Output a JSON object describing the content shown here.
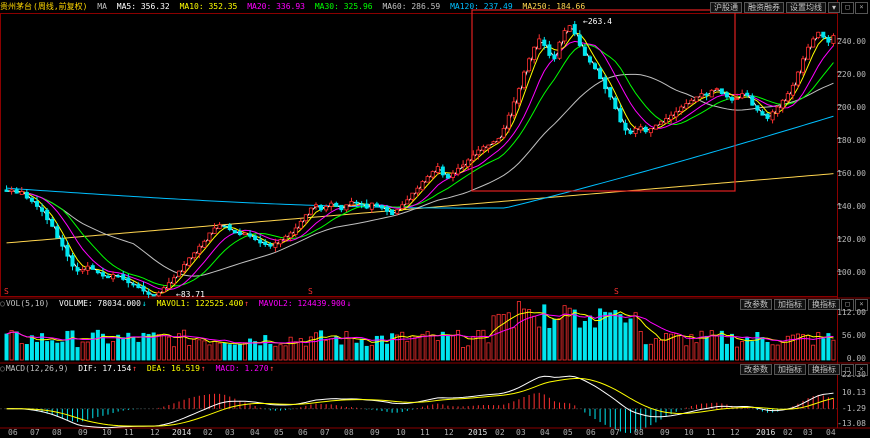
{
  "stock_name": "贵州茅台",
  "adjust_mode": "(周线,前复权)",
  "price_header": {
    "prefix": "MA",
    "items": [
      {
        "label": "MA5: 356.32",
        "color": "#ffffff"
      },
      {
        "label": "MA10: 352.35",
        "color": "#ffff00"
      },
      {
        "label": "MA20: 336.93",
        "color": "#ff00ff"
      },
      {
        "label": "MA30: 325.96",
        "color": "#00ff00"
      },
      {
        "label": "MA60: 286.59",
        "color": "#c0c0c0"
      },
      {
        "label": "MA120: 237.49",
        "color": "#00bfff"
      },
      {
        "label": "MA250: 184.66",
        "color": "#ffd54f"
      }
    ]
  },
  "top_buttons": [
    "沪股通",
    "融资融券",
    "设置均线"
  ],
  "vol_header": {
    "name": "VOL(5,10)",
    "volume": "VOLUME: 78034.000",
    "mavol1": "MAVOL1: 122525.400",
    "mavol2": "MAVOL2: 124439.900"
  },
  "macd_header": {
    "name": "MACD(12,26,9)",
    "dif": "DIF: 17.154",
    "dea": "DEA: 16.519",
    "macd": "MACD: 1.270"
  },
  "panel_buttons": [
    "改参数",
    "加指标",
    "换指标"
  ],
  "annotations": {
    "high": "263.4",
    "low": "83.71"
  },
  "colors": {
    "up": "#ff3030",
    "down": "#00e5ee",
    "selection": "#e02020",
    "grid": "#8b0000"
  },
  "price_axis": [
    "240.00",
    "220.00",
    "200.00",
    "180.00",
    "160.00",
    "140.00",
    "120.00",
    "100.00"
  ],
  "vol_axis": [
    "112.00",
    "56.00",
    "0.00"
  ],
  "macd_axis": [
    "22.30",
    "10.13",
    "-1.29",
    "-13.08"
  ],
  "time_axis": [
    {
      "t": "06",
      "x": 8
    },
    {
      "t": "07",
      "x": 30
    },
    {
      "t": "08",
      "x": 52
    },
    {
      "t": "09",
      "x": 78
    },
    {
      "t": "10",
      "x": 102
    },
    {
      "t": "11",
      "x": 124
    },
    {
      "t": "12",
      "x": 150
    },
    {
      "t": "2014",
      "x": 172,
      "year": true
    },
    {
      "t": "02",
      "x": 203
    },
    {
      "t": "03",
      "x": 225
    },
    {
      "t": "04",
      "x": 250
    },
    {
      "t": "05",
      "x": 274
    },
    {
      "t": "06",
      "x": 298
    },
    {
      "t": "07",
      "x": 320
    },
    {
      "t": "08",
      "x": 344
    },
    {
      "t": "09",
      "x": 370
    },
    {
      "t": "10",
      "x": 396
    },
    {
      "t": "11",
      "x": 420
    },
    {
      "t": "12",
      "x": 444
    },
    {
      "t": "2015",
      "x": 468,
      "year": true
    },
    {
      "t": "02",
      "x": 495
    },
    {
      "t": "03",
      "x": 516
    },
    {
      "t": "04",
      "x": 540
    },
    {
      "t": "05",
      "x": 563
    },
    {
      "t": "06",
      "x": 586
    },
    {
      "t": "07",
      "x": 610
    },
    {
      "t": "08",
      "x": 634
    },
    {
      "t": "09",
      "x": 660
    },
    {
      "t": "10",
      "x": 684
    },
    {
      "t": "11",
      "x": 706
    },
    {
      "t": "12",
      "x": 730
    },
    {
      "t": "2016",
      "x": 756,
      "year": true
    },
    {
      "t": "02",
      "x": 783
    },
    {
      "t": "03",
      "x": 803
    },
    {
      "t": "04",
      "x": 826
    }
  ],
  "chart_data": {
    "type": "candlestick",
    "x_range": [
      "2013-06",
      "2016-04"
    ],
    "ylim": [
      85,
      255
    ],
    "closes": [
      148,
      149,
      147,
      148,
      144,
      142,
      139,
      136,
      131,
      127,
      120,
      115,
      109,
      103,
      100,
      101,
      103,
      101,
      99,
      97,
      96,
      98,
      97,
      95,
      93,
      92,
      90,
      88,
      86,
      85,
      87,
      90,
      93,
      96,
      100,
      104,
      108,
      111,
      115,
      118,
      123,
      126,
      128,
      127,
      125,
      123,
      122,
      123,
      121,
      119,
      117,
      116,
      115,
      117,
      119,
      121,
      123,
      126,
      130,
      134,
      138,
      140,
      137,
      139,
      141,
      139,
      137,
      140,
      142,
      141,
      140,
      138,
      141,
      139,
      138,
      136,
      134,
      137,
      140,
      143,
      147,
      150,
      154,
      157,
      160,
      163,
      158,
      156,
      159,
      162,
      164,
      167,
      170,
      173,
      175,
      176,
      178,
      180,
      186,
      194,
      202,
      210,
      220,
      228,
      235,
      240,
      236,
      230,
      228,
      238,
      245,
      248,
      243,
      236,
      230,
      226,
      222,
      216,
      210,
      205,
      198,
      190,
      185,
      183,
      186,
      187,
      184,
      186,
      188,
      190,
      192,
      194,
      196,
      199,
      201,
      203,
      205,
      207,
      206,
      209,
      210,
      207,
      205,
      203,
      204,
      207,
      206,
      200,
      197,
      194,
      192,
      196,
      199,
      203,
      207,
      212,
      220,
      228,
      235,
      240,
      244,
      241,
      238,
      242
    ]
  }
}
